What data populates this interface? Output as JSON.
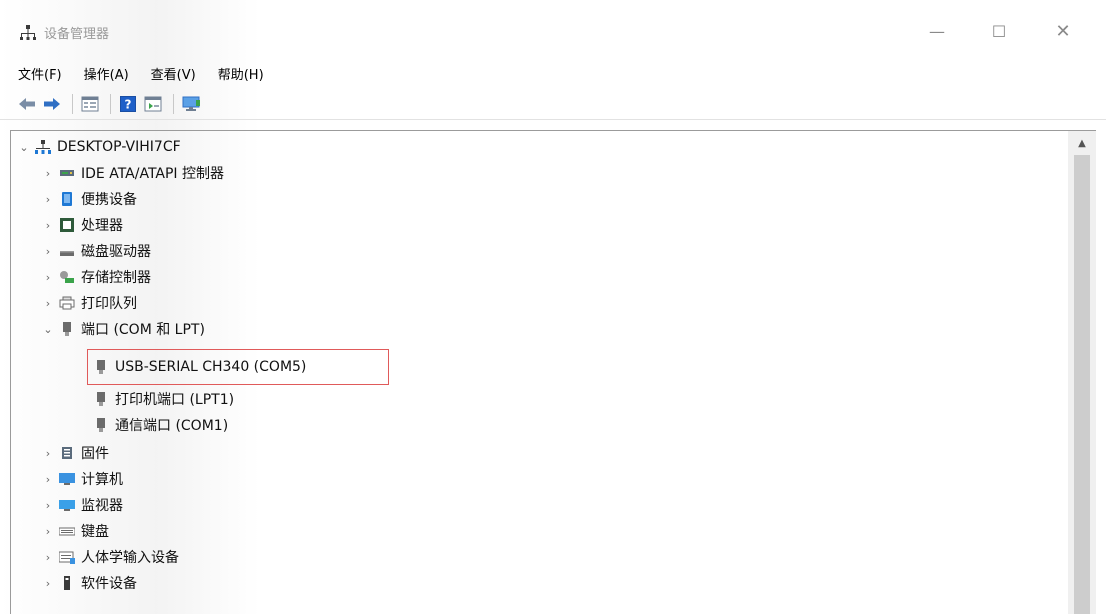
{
  "window": {
    "title": "设备管理器",
    "minimize": "—",
    "maximize": "☐",
    "close": "✕"
  },
  "menu": [
    "文件(F)",
    "操作(A)",
    "查看(V)",
    "帮助(H)"
  ],
  "toolbar": {
    "buttons": [
      "back-icon",
      "forward-icon",
      "properties-icon",
      "help-icon",
      "view-icon",
      "monitor-icon"
    ]
  },
  "tree": {
    "root": {
      "label": "DESKTOP-VIHI7CF",
      "expanded": true,
      "icon": "computer-icon"
    },
    "items": [
      {
        "label": "IDE ATA/ATAPI 控制器",
        "expanded": false,
        "icon": "ide-controller-icon"
      },
      {
        "label": "便携设备",
        "expanded": false,
        "icon": "portable-device-icon"
      },
      {
        "label": "处理器",
        "expanded": false,
        "icon": "processor-icon"
      },
      {
        "label": "磁盘驱动器",
        "expanded": false,
        "icon": "disk-drive-icon"
      },
      {
        "label": "存储控制器",
        "expanded": false,
        "icon": "storage-controller-icon"
      },
      {
        "label": "打印队列",
        "expanded": false,
        "icon": "print-queue-icon"
      },
      {
        "label": "端口 (COM 和 LPT)",
        "expanded": true,
        "icon": "port-icon",
        "children": [
          {
            "label": "USB-SERIAL CH340 (COM5)",
            "icon": "port-icon",
            "highlighted": true
          },
          {
            "label": "打印机端口 (LPT1)",
            "icon": "port-icon"
          },
          {
            "label": "通信端口 (COM1)",
            "icon": "port-icon"
          }
        ]
      },
      {
        "label": "固件",
        "expanded": false,
        "icon": "firmware-icon"
      },
      {
        "label": "计算机",
        "expanded": false,
        "icon": "computer-monitor-icon"
      },
      {
        "label": "监视器",
        "expanded": false,
        "icon": "monitor-icon"
      },
      {
        "label": "键盘",
        "expanded": false,
        "icon": "keyboard-icon"
      },
      {
        "label": "人体学输入设备",
        "expanded": false,
        "icon": "hid-icon"
      },
      {
        "label": "软件设备",
        "expanded": false,
        "icon": "software-device-icon"
      }
    ]
  },
  "colors": {
    "highlight_border": "#e05a5a",
    "accent_blue": "#1e78d4"
  }
}
